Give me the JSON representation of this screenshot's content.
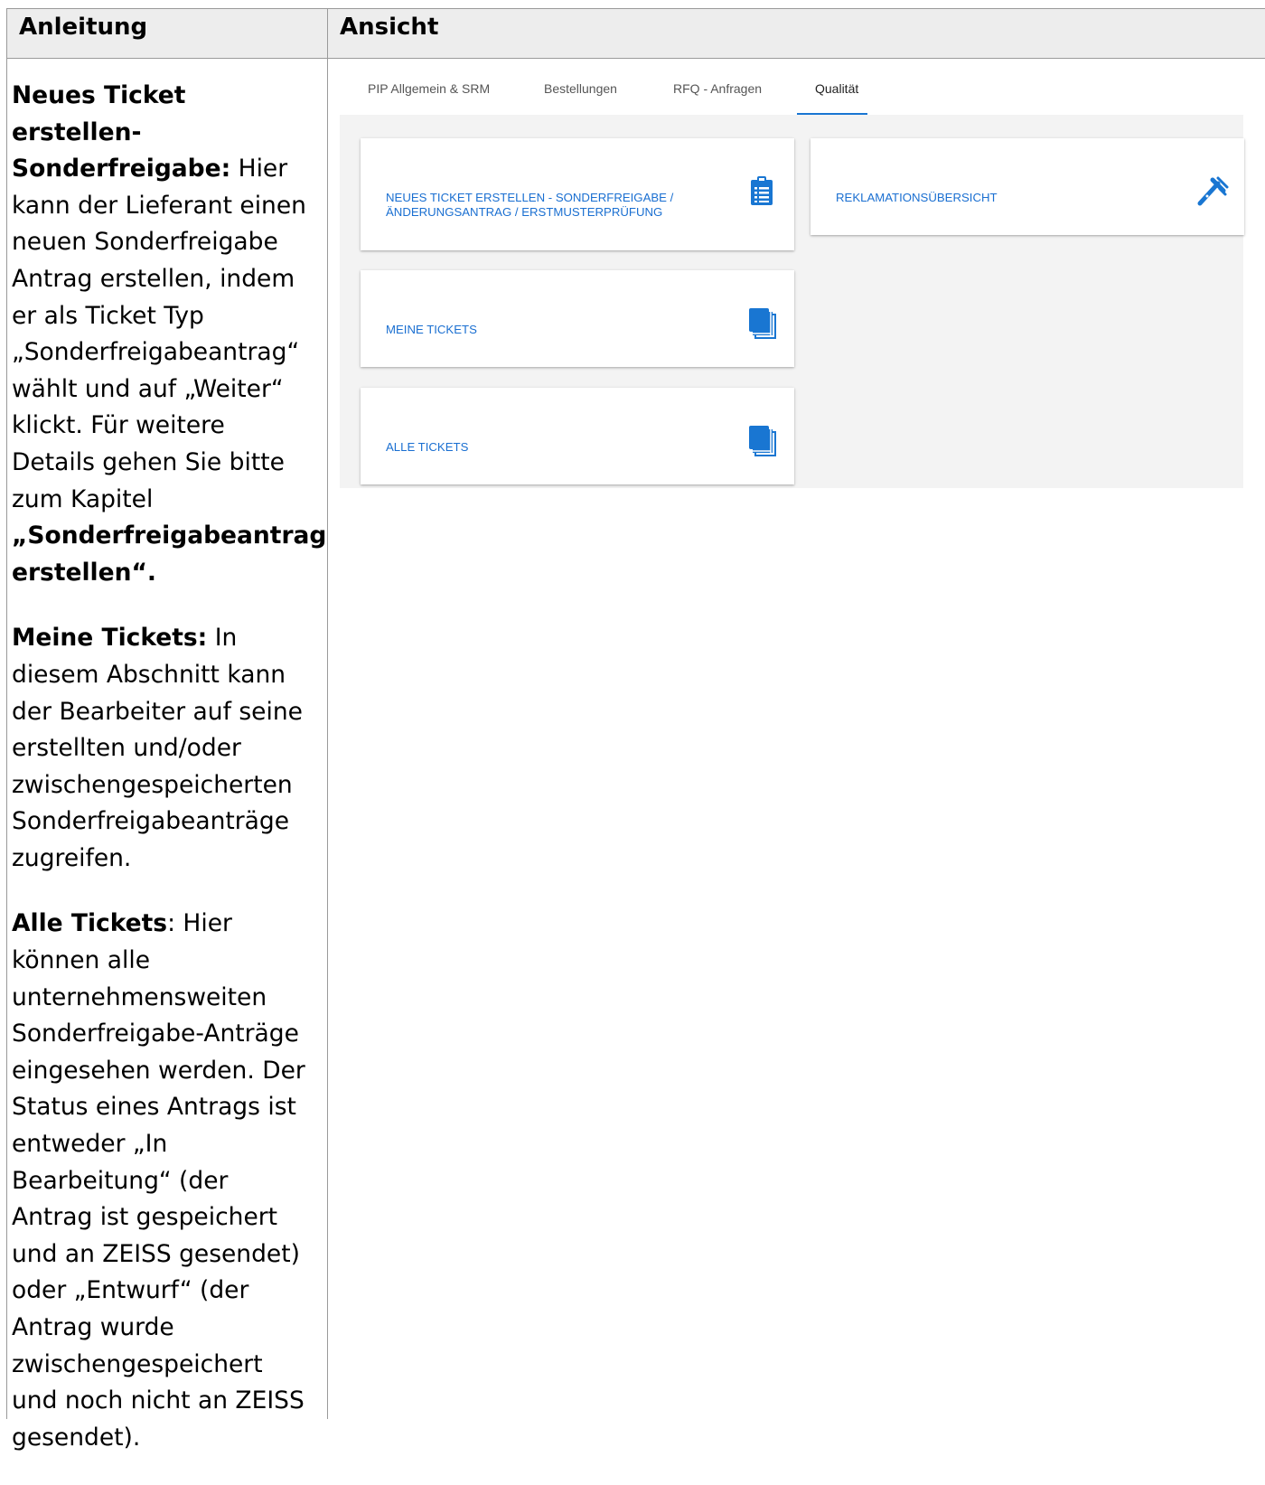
{
  "header": {
    "left": "Anleitung",
    "right": "Ansicht"
  },
  "instructions": {
    "p1_bold": "Neues Ticket erstellen- Sonderfreigabe:",
    "p1_text": " Hier kann der Lieferant einen neuen Sonderfreigabe Antrag erstellen, indem er als Ticket Typ „Sonderfreigabeantrag“ wählt und auf „Weiter“ klickt. Für weitere Details gehen Sie bitte zum Kapitel ",
    "p1_bold2": "„Sonderfreigabeantrag erstellen“.",
    "p2_bold": "Meine Tickets:",
    "p2_text": " In diesem Abschnitt kann der Bearbeiter auf seine erstellten und/oder zwischengespeicherten Sonderfreigabeanträge zugreifen.",
    "p3_bold": "Alle Tickets",
    "p3_text": ": Hier können alle unternehmensweiten Sonderfreigabe-Anträge eingesehen werden. Der Status eines Antrags ist entweder „In Bearbeitung“ (der Antrag ist gespeichert und an ZEISS gesendet) oder „Entwurf“ (der Antrag wurde zwischengespeichert und noch nicht an ZEISS gesendet)."
  },
  "tabs": [
    "PIP Allgemein & SRM",
    "Bestellungen",
    "RFQ - Anfragen",
    "Qualität"
  ],
  "active_tab": "Qualität",
  "cards": {
    "new_ticket_line1": "NEUES TICKET ERSTELLEN - SONDERFREIGABE /",
    "new_ticket_line2": "ÄNDERUNGSANTRAG / ERSTMUSTERPRÜFUNG",
    "new_ticket_icon": "clipboard-icon",
    "my_tickets": "MEINE TICKETS",
    "my_tickets_icon": "documents-icon",
    "all_tickets": "ALLE TICKETS",
    "all_tickets_icon": "documents-icon",
    "complaints": "REKLAMATIONSÜBERSICHT",
    "complaints_icon": "caliper-icon"
  },
  "colors": {
    "accent": "#1976d2",
    "link": "#1a6fd1",
    "header_bg": "#ededed",
    "panel_bg": "#f3f3f3"
  }
}
